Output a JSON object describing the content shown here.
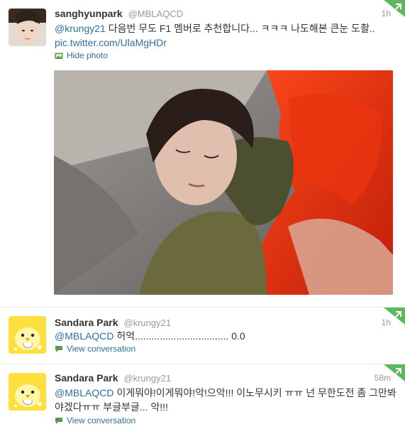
{
  "tweets": [
    {
      "fullname": "sanghyunpark",
      "username": "@MBLAQCD",
      "time": "1h",
      "mention": "@krungy21",
      "text": " 다음번 무도 F1 멤버로 추천합니다... ㅋㅋㅋ 나도해본 큰눈 도촬.. ",
      "link": "pic.twitter.com/UlaMgHDr",
      "action": "Hide photo",
      "action_icon": "photo-icon"
    },
    {
      "fullname": "Sandara Park",
      "username": "@krungy21",
      "time": "1h",
      "mention": "@MBLAQCD",
      "text": " 허억.................................. 0.0",
      "action": "View conversation",
      "action_icon": "conversation-icon"
    },
    {
      "fullname": "Sandara Park",
      "username": "@krungy21",
      "time": "58m",
      "mention": "@MBLAQCD",
      "text": " 이게뭐야!이게뭐야!악!으악!!! 이노무시키 ㅠㅠ 넌 무한도전 좀 그만봐야겠다ㅠㅠ 부글부글... 악!!!",
      "action": "View conversation",
      "action_icon": "conversation-icon"
    }
  ],
  "colors": {
    "link": "#2f6f9f",
    "muted": "#999999",
    "text": "#333333",
    "corner_badge": "#5cb85c"
  }
}
